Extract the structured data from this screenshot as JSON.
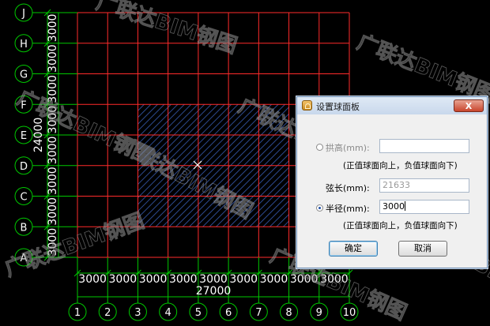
{
  "canvas": {
    "row_labels": [
      "J",
      "H",
      "G",
      "F",
      "E",
      "D",
      "C",
      "B",
      "A"
    ],
    "row_spacings": [
      "3000",
      "3000",
      "3000",
      "3000",
      "3000",
      "3000",
      "3000",
      "3000"
    ],
    "row_total": "24000",
    "col_labels": [
      "1",
      "2",
      "3",
      "4",
      "5",
      "6",
      "7",
      "8",
      "9",
      "10"
    ],
    "col_spacings": [
      "3000",
      "3000",
      "3000",
      "3000",
      "3000",
      "3000",
      "3000",
      "3000",
      "3000"
    ],
    "col_total": "27000",
    "cursor_icon": "crosshair-icon",
    "watermark_text": "广联达BIM钢图",
    "colors": {
      "background": "#000000",
      "grid": "#ff2b2b",
      "axis": "#00c800",
      "hatch": "#2a3f7a"
    }
  },
  "dialog": {
    "title": "设置球面板",
    "close_label": "X",
    "arch_height": {
      "label": "拱高(mm):",
      "value": "",
      "selected": false,
      "hint": "(正值球面向上，负值球面向下)"
    },
    "chord": {
      "label": "弦长(mm):",
      "value": "21633"
    },
    "radius": {
      "label": "半径(mm):",
      "value": "3000",
      "selected": true,
      "hint": "(正值球面向上，负值球面向下)"
    },
    "ok_label": "确定",
    "cancel_label": "取消"
  }
}
